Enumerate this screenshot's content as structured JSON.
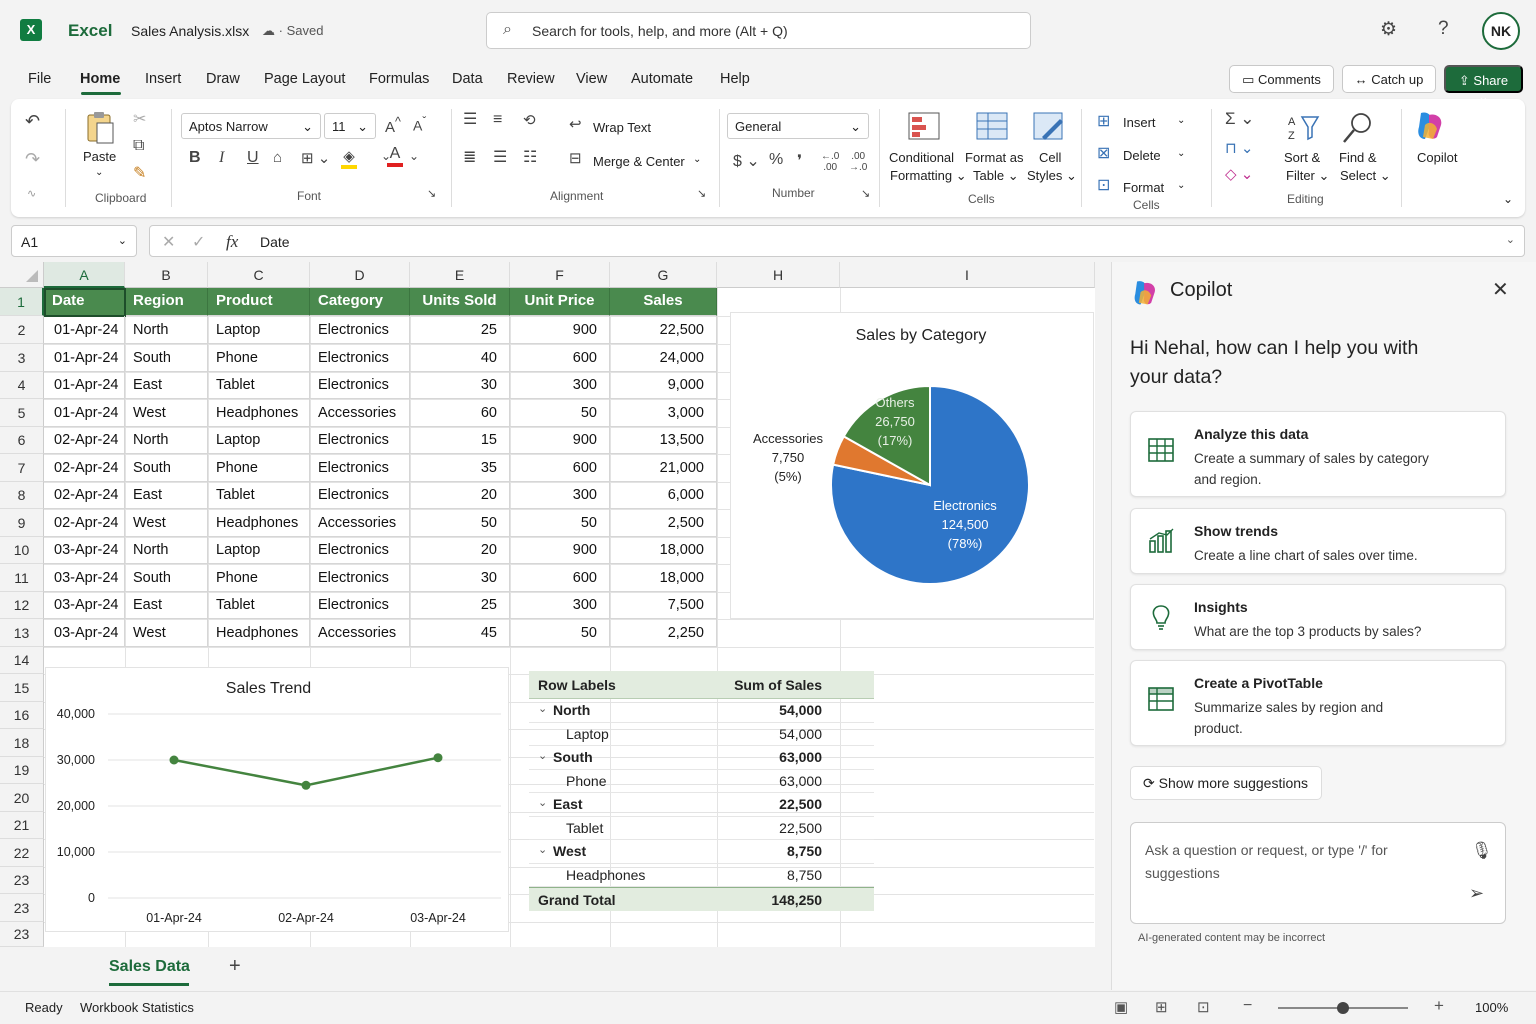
{
  "titlebar": {
    "app_name": "Excel",
    "file_name": "Sales Analysis.xlsx",
    "save_status": "Saved",
    "search_placeholder": "Search for tools, help, and more (Alt + Q)",
    "user_initials": "NK"
  },
  "menu": {
    "items": [
      "File",
      "Home",
      "Insert",
      "Draw",
      "Page Layout",
      "Formulas",
      "Data",
      "Review",
      "View",
      "Automate",
      "Help"
    ],
    "active": "Home",
    "comments_label": "Comments",
    "catchup_label": "Catch up",
    "share_label": "Share"
  },
  "ribbon": {
    "clipboard": {
      "paste": "Paste",
      "group": "Clipboard"
    },
    "font": {
      "name": "Aptos Narrow",
      "size": "11",
      "group": "Font"
    },
    "alignment": {
      "wrap": "Wrap Text",
      "merge": "Merge & Center",
      "group": "Alignment"
    },
    "number": {
      "format": "General",
      "group": "Number"
    },
    "styles": {
      "conditional_1": "Conditional",
      "conditional_2": "Formatting",
      "format_table_1": "Format as",
      "format_table_2": "Table",
      "cell_styles_1": "Cell",
      "cell_styles_2": "Styles",
      "group": "Cells"
    },
    "cells": {
      "insert": "Insert",
      "delete": "Delete",
      "format": "Format",
      "group": "Cells"
    },
    "editing": {
      "sort_1": "Sort &",
      "sort_2": "Filter",
      "find_1": "Find &",
      "find_2": "Select",
      "group": "Editing"
    },
    "copilot": "Copilot"
  },
  "formula_bar": {
    "name_box": "A1",
    "fx": "fx",
    "value": "Date"
  },
  "sheet": {
    "columns": [
      "A",
      "B",
      "C",
      "D",
      "E",
      "F",
      "G",
      "H",
      "I"
    ],
    "row_numbers": [
      "1",
      "2",
      "3",
      "4",
      "5",
      "6",
      "7",
      "8",
      "9",
      "10",
      "11",
      "12",
      "13",
      "14",
      "15",
      "16",
      "18",
      "19",
      "20",
      "21",
      "22",
      "23",
      "23",
      "23"
    ],
    "headers": [
      "Date",
      "Region",
      "Product",
      "Category",
      "Units Sold",
      "Unit Price",
      "Sales"
    ],
    "rows": [
      [
        "01-Apr-24",
        "North",
        "Laptop",
        "Electronics",
        "25",
        "900",
        "22,500"
      ],
      [
        "01-Apr-24",
        "South",
        "Phone",
        "Electronics",
        "40",
        "600",
        "24,000"
      ],
      [
        "01-Apr-24",
        "East",
        "Tablet",
        "Electronics",
        "30",
        "300",
        "9,000"
      ],
      [
        "01-Apr-24",
        "West",
        "Headphones",
        "Accessories",
        "60",
        "50",
        "3,000"
      ],
      [
        "02-Apr-24",
        "North",
        "Laptop",
        "Electronics",
        "15",
        "900",
        "13,500"
      ],
      [
        "02-Apr-24",
        "South",
        "Phone",
        "Electronics",
        "35",
        "600",
        "21,000"
      ],
      [
        "02-Apr-24",
        "East",
        "Tablet",
        "Electronics",
        "20",
        "300",
        "6,000"
      ],
      [
        "02-Apr-24",
        "West",
        "Headphones",
        "Accessories",
        "50",
        "50",
        "2,500"
      ],
      [
        "03-Apr-24",
        "North",
        "Laptop",
        "Electronics",
        "20",
        "900",
        "18,000"
      ],
      [
        "03-Apr-24",
        "South",
        "Phone",
        "Electronics",
        "30",
        "600",
        "18,000"
      ],
      [
        "03-Apr-24",
        "East",
        "Tablet",
        "Electronics",
        "25",
        "300",
        "7,500"
      ],
      [
        "03-Apr-24",
        "West",
        "Headphones",
        "Accessories",
        "45",
        "50",
        "2,250"
      ]
    ]
  },
  "chart_data": [
    {
      "type": "pie",
      "title": "Sales by Category",
      "slices": [
        {
          "label": "Electronics",
          "value": 124500,
          "value_label": "124,500",
          "pct_label": "(78%)",
          "color": "#2e75c8"
        },
        {
          "label": "Accessories",
          "value": 7750,
          "value_label": "7,750",
          "pct_label": "(5%)",
          "color": "#e0782f"
        },
        {
          "label": "Others",
          "value": 26750,
          "value_label": "26,750",
          "pct_label": "(17%)",
          "color": "#44843f"
        }
      ]
    },
    {
      "type": "line",
      "title": "Sales Trend",
      "categories": [
        "01-Apr-24",
        "02-Apr-24",
        "03-Apr-24"
      ],
      "series": [
        {
          "values": [
            30000,
            24500,
            30500
          ],
          "color": "#44843f"
        }
      ],
      "ylim": [
        0,
        40000
      ],
      "yticks": [
        "40,000",
        "30,000",
        "20,000",
        "10,000",
        "0"
      ],
      "grid": true
    }
  ],
  "pivot": {
    "header_labels": "Row Labels",
    "header_values": "Sum of Sales",
    "rows": [
      {
        "label": "North",
        "value": "54,000",
        "bold": true,
        "expander": true
      },
      {
        "label": "Laptop",
        "value": "54,000",
        "bold": false,
        "expander": false
      },
      {
        "label": "South",
        "value": "63,000",
        "bold": true,
        "expander": true
      },
      {
        "label": "Phone",
        "value": "63,000",
        "bold": false,
        "expander": false
      },
      {
        "label": "East",
        "value": "22,500",
        "bold": true,
        "expander": true
      },
      {
        "label": "Tablet",
        "value": "22,500",
        "bold": false,
        "expander": false
      },
      {
        "label": "West",
        "value": "8,750",
        "bold": true,
        "expander": true
      },
      {
        "label": "Headphones",
        "value": "8,750",
        "bold": false,
        "expander": false
      }
    ],
    "grand_total_label": "Grand Total",
    "grand_total_value": "148,250"
  },
  "tabs": {
    "active": "Sales Data",
    "add": "+"
  },
  "status": {
    "ready": "Ready",
    "stats": "Workbook Statistics",
    "zoom": "100%",
    "zoom_level": 0.5
  },
  "copilot": {
    "title": "Copilot",
    "greeting": "Hi Nehal, how can I help you with your data?",
    "suggestions": [
      {
        "title": "Analyze this data",
        "desc": "Create a summary of sales by category and region.",
        "icon": "table-grid-icon"
      },
      {
        "title": "Show trends",
        "desc": "Create a line chart of sales over time.",
        "icon": "bar-chart-icon"
      },
      {
        "title": "Insights",
        "desc": "What are the top 3 products by sales?",
        "icon": "lightbulb-icon"
      },
      {
        "title": "Create a PivotTable",
        "desc": "Summarize sales by region and product.",
        "icon": "pivot-table-icon"
      }
    ],
    "more": "Show more suggestions",
    "input_placeholder": "Ask a question or request, or type '/' for suggestions",
    "disclaimer": "AI-generated content may be incorrect"
  },
  "colors": {
    "accent": "#1d6b3b",
    "header_fill": "#4a8a4e"
  }
}
